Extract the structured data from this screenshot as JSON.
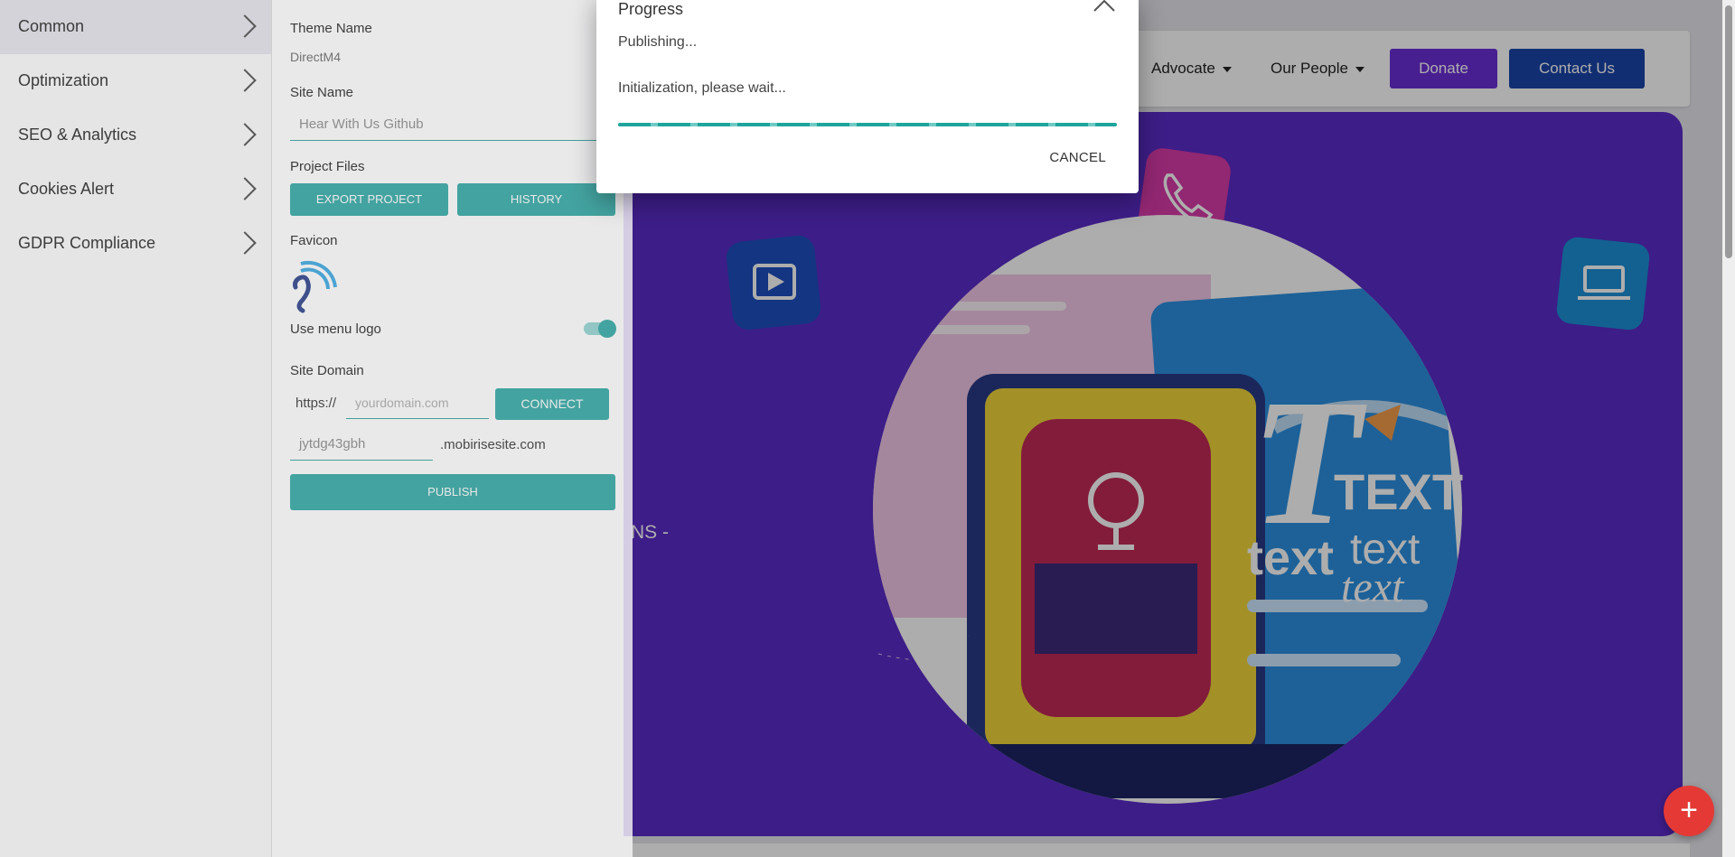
{
  "sidebar": {
    "items": [
      {
        "label": "Common",
        "active": true
      },
      {
        "label": "Optimization"
      },
      {
        "label": "SEO & Analytics"
      },
      {
        "label": "Cookies Alert"
      },
      {
        "label": "GDPR Compliance"
      }
    ]
  },
  "settings": {
    "theme_name_label": "Theme Name",
    "theme_name_value": "DirectM4",
    "site_name_label": "Site Name",
    "site_name_value": "Hear With Us Github",
    "project_files_label": "Project Files",
    "export_button": "EXPORT PROJECT",
    "history_button": "HISTORY",
    "favicon_label": "Favicon",
    "use_menu_logo_label": "Use menu logo",
    "use_menu_logo_on": true,
    "site_domain_label": "Site Domain",
    "protocol": "https://",
    "domain_placeholder": "yourdomain.com",
    "connect_button": "CONNECT",
    "subdomain_value": "jytdg43gbh",
    "subdomain_suffix": ".mobirisesite.com",
    "publish_button": "PUBLISH"
  },
  "site": {
    "nav": [
      {
        "label": "Advocate"
      },
      {
        "label": "Our People"
      }
    ],
    "donate_button": "Donate",
    "contact_button": "Contact Us",
    "hero_text_fragment": "NS -",
    "colors": {
      "hero_bg": "#5a2bc8",
      "donate": "#6a2fd6",
      "contact": "#1a44a8",
      "accent": "#2ba5a0",
      "fab": "#e53935"
    },
    "hero_illustration_words": [
      "TEXT",
      "text",
      "text",
      "text",
      "T"
    ]
  },
  "dialog": {
    "title": "Progress",
    "status": "Publishing...",
    "message": "Initialization, please wait...",
    "progress": 1.0,
    "cancel_button": "CANCEL"
  }
}
